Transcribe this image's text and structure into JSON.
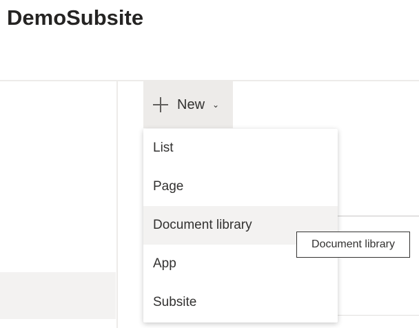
{
  "site": {
    "title": "DemoSubsite"
  },
  "toolbar": {
    "new_label": "New"
  },
  "menu": {
    "items": [
      {
        "label": "List"
      },
      {
        "label": "Page"
      },
      {
        "label": "Document library"
      },
      {
        "label": "App"
      },
      {
        "label": "Subsite"
      }
    ]
  },
  "tooltip": {
    "text": "Document library"
  }
}
